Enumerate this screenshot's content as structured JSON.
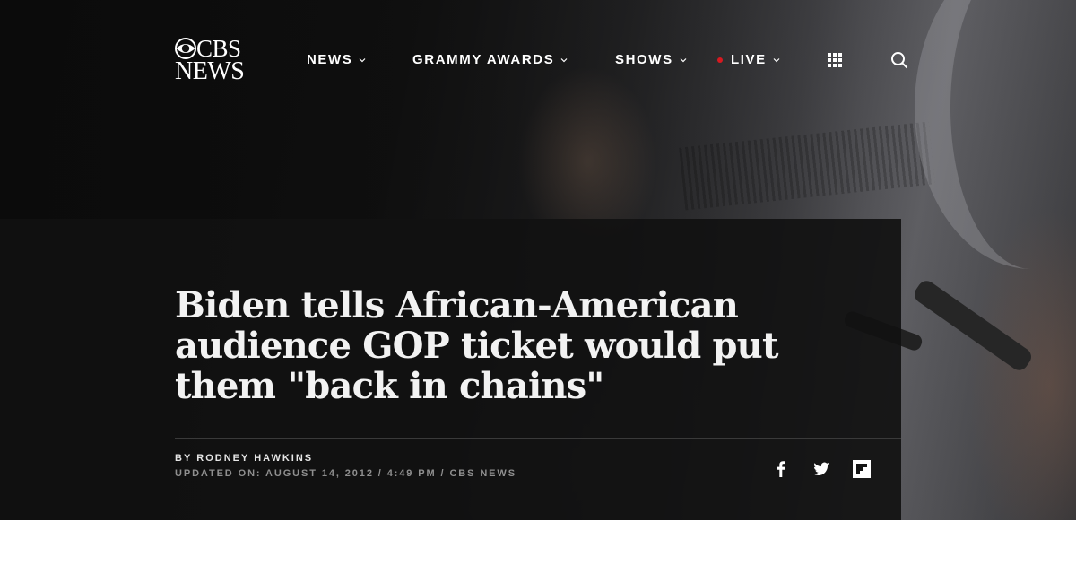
{
  "brand": {
    "line1": "CBS",
    "line2": "NEWS"
  },
  "nav": {
    "items": [
      {
        "label": "NEWS",
        "icon": "chevron-down-icon"
      },
      {
        "label": "GRAMMY AWARDS",
        "icon": "chevron-down-icon"
      },
      {
        "label": "SHOWS",
        "icon": "chevron-down-icon"
      },
      {
        "label": "LIVE",
        "icon": "chevron-down-icon",
        "indicator_color": "#d71920"
      }
    ],
    "grid_icon": "grid-menu-icon",
    "search_icon": "search-icon"
  },
  "article": {
    "headline": "Biden tells African-American audience GOP ticket would put them \"back in chains\"",
    "byline_prefix": "BY",
    "author": "RODNEY HAWKINS",
    "updated": "UPDATED ON: AUGUST 14, 2012 / 4:49 PM / CBS NEWS"
  },
  "share": {
    "icons": [
      "facebook-icon",
      "twitter-icon",
      "flipboard-icon"
    ]
  },
  "colors": {
    "live_dot": "#d71920",
    "panel": "#111111",
    "text": "#ffffff"
  }
}
